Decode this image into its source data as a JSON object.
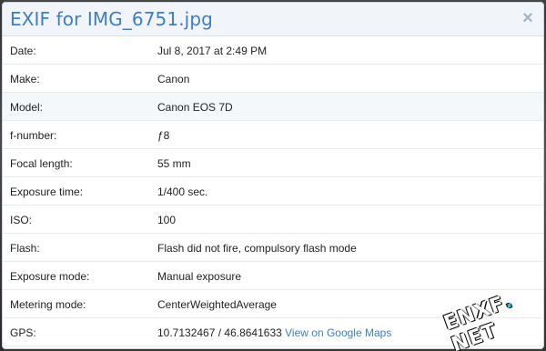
{
  "dialog": {
    "title": "EXIF for IMG_6751.jpg",
    "close_icon": "×"
  },
  "rows": [
    {
      "label": "Date:",
      "value": "Jul 8, 2017 at 2:49 PM"
    },
    {
      "label": "Make:",
      "value": "Canon"
    },
    {
      "label": "Model:",
      "value": "Canon EOS 7D"
    },
    {
      "label": "f-number:",
      "value": "ƒ8"
    },
    {
      "label": "Focal length:",
      "value": "55 mm"
    },
    {
      "label": "Exposure time:",
      "value": "1/400 sec."
    },
    {
      "label": "ISO:",
      "value": "100"
    },
    {
      "label": "Flash:",
      "value": "Flash did not fire, compulsory flash mode"
    },
    {
      "label": "Exposure mode:",
      "value": "Manual exposure"
    },
    {
      "label": "Metering mode:",
      "value": "CenterWeightedAverage"
    },
    {
      "label": "GPS:",
      "value": "10.7132467 / 46.8641633",
      "link": "View on Google Maps"
    }
  ],
  "watermark": {
    "text_main": "ENXF",
    "text_dot": ".",
    "text_tld": "NET",
    "colors": {
      "dot": "#2bbbe6",
      "text": "#ffffff"
    }
  },
  "colors": {
    "title": "#3f7fbf",
    "header_bg": "#f1f5fa",
    "row_alt_bg": "#f5f8fb",
    "link": "#3f7fbf"
  }
}
